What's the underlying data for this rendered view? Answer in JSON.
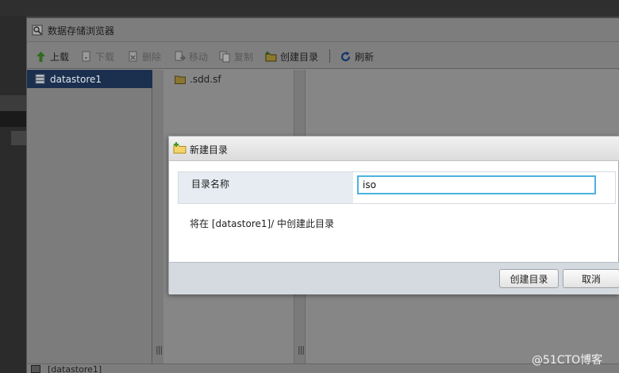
{
  "window": {
    "title": "数据存储浏览器",
    "icon": "datastore-browser-icon"
  },
  "toolbar": {
    "upload": "上载",
    "download": "下载",
    "delete": "删除",
    "move": "移动",
    "copy": "复制",
    "create_dir": "创建目录",
    "refresh": "刷新"
  },
  "tree": {
    "items": [
      {
        "label": "datastore1",
        "icon": "datastore-icon",
        "selected": true
      }
    ]
  },
  "files": {
    "items": [
      {
        "label": ".sdd.sf",
        "icon": "folder-icon"
      }
    ]
  },
  "status": {
    "path": "[datastore1]"
  },
  "dialog": {
    "title": "新建目录",
    "field_label": "目录名称",
    "field_value": "iso",
    "hint": "将在 [datastore1]/ 中创建此目录",
    "create_button": "创建目录",
    "cancel_button": "取消"
  },
  "watermark": "@51CTO博客",
  "colors": {
    "input_focus": "#4bb3e0",
    "tree_selected": "#1b2f4e",
    "dialog_footer": "#d5dae0"
  }
}
